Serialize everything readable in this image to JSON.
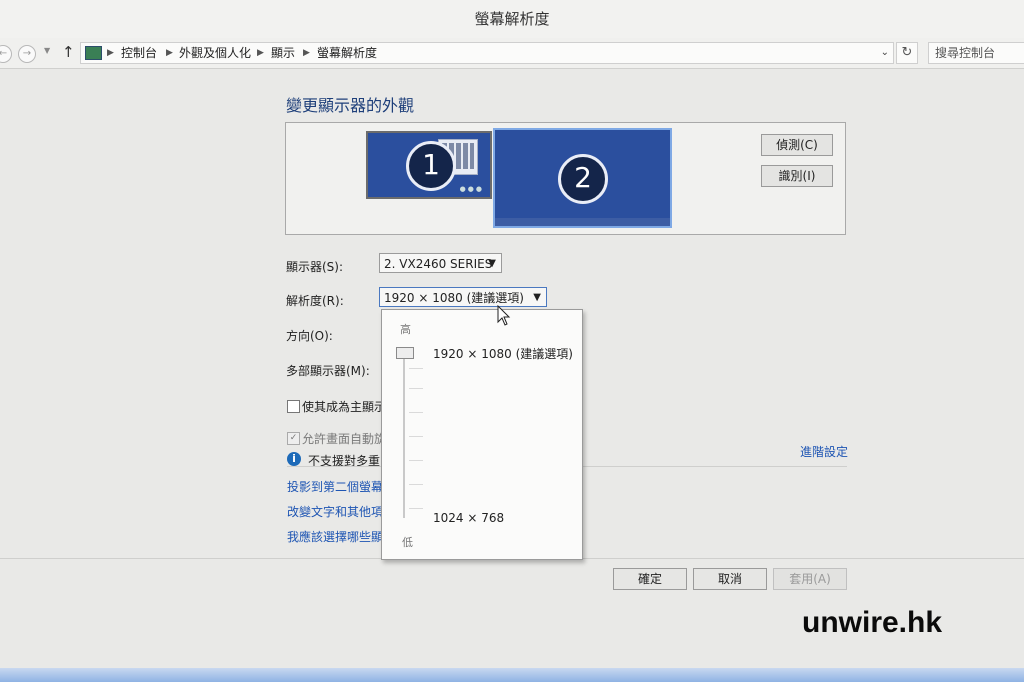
{
  "window": {
    "title": "螢幕解析度"
  },
  "addressbar": {
    "crumbs": [
      "控制台",
      "外觀及個人化",
      "顯示",
      "螢幕解析度"
    ],
    "search_placeholder": "搜尋控制台"
  },
  "main": {
    "heading": "變更顯示器的外觀",
    "monitors": [
      "1",
      "2"
    ],
    "detect_label": "偵測(C)",
    "identify_label": "識別(I)",
    "display_label": "顯示器(S):",
    "display_value": "2. VX2460 SERIES",
    "resolution_label": "解析度(R):",
    "resolution_value": "1920 × 1080 (建議選項)",
    "orientation_label": "方向(O):",
    "multi_display_label": "多部顯示器(M):",
    "make_main_label": "使其成為主顯示",
    "auto_rotate_label": "允許畫面自動旋",
    "info_text": "不支援對多重",
    "advanced_link": "進階設定",
    "links": [
      "投影到第二個螢幕",
      "改變文字和其他項",
      "我應該選擇哪些顯"
    ]
  },
  "resolution_dropdown": {
    "high_label": "高",
    "low_label": "低",
    "top_option": "1920 × 1080 (建議選項)",
    "bottom_option": "1024 × 768"
  },
  "buttons": {
    "ok": "確定",
    "cancel": "取消",
    "apply": "套用(A)"
  },
  "watermark": "unwire.hk",
  "colors": {
    "monitor_fill": "#2b4f9e",
    "link": "#1e55b3",
    "heading": "#1e3f7a"
  }
}
